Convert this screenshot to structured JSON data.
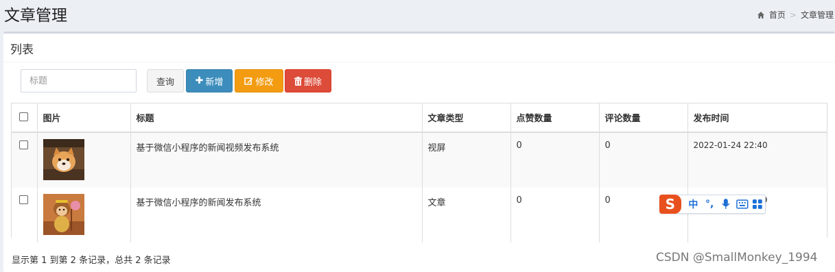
{
  "page": {
    "title": "文章管理",
    "breadcrumb": {
      "home": "首页",
      "sep": ">",
      "current": "文章管理"
    }
  },
  "box": {
    "title": "列表"
  },
  "toolbar": {
    "search_placeholder": "标题",
    "query_label": "查询",
    "add_label": "新增",
    "edit_label": "修改",
    "delete_label": "删除",
    "add_icon": "plus-icon",
    "edit_icon": "edit-icon",
    "delete_icon": "trash-icon"
  },
  "table": {
    "headers": [
      "图片",
      "标题",
      "文章类型",
      "点赞数量",
      "评论数量",
      "发布时间"
    ],
    "rows": [
      {
        "image": "shiba-dog-image",
        "title": "基于微信小程序的新闻视频发布系统",
        "type": "视屏",
        "likes": "0",
        "comments": "0",
        "time": "2022-01-24 22:40"
      },
      {
        "image": "monkey-cartoon-image",
        "title": "基于微信小程序的新闻发布系统",
        "type": "文章",
        "likes": "0",
        "comments": "0",
        "time": "2022-01-24 22:39"
      }
    ]
  },
  "footer": {
    "summary": "显示第 1 到第 2 条记录，总共 2 条记录"
  },
  "watermark": "CSDN @SmallMonkey_1994",
  "ime": {
    "logo": "S",
    "mode": "中",
    "punct": "°,",
    "mic": "mic-icon",
    "keyboard": "keyboard-icon",
    "apps": "apps-icon"
  },
  "colors": {
    "primary": "#3c8dbc",
    "warning": "#f39c12",
    "danger": "#dd4b39",
    "ime": "#e8501e"
  }
}
